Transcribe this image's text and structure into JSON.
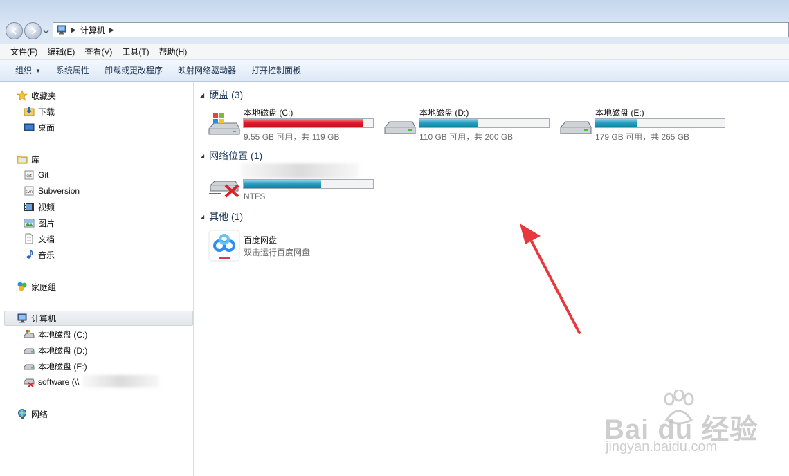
{
  "window": {
    "breadcrumb": [
      "计算机"
    ]
  },
  "menubar": {
    "items": [
      "文件(F)",
      "编辑(E)",
      "查看(V)",
      "工具(T)",
      "帮助(H)"
    ]
  },
  "toolbar": {
    "items": [
      "组织",
      "系统属性",
      "卸载或更改程序",
      "映射网络驱动器",
      "打开控制面板"
    ]
  },
  "sidebar": {
    "favorites": {
      "label": "收藏夹",
      "items": [
        "下载",
        "桌面"
      ]
    },
    "libraries": {
      "label": "库",
      "items": [
        "Git",
        "Subversion",
        "视频",
        "图片",
        "文档",
        "音乐"
      ]
    },
    "homegroup": {
      "label": "家庭组"
    },
    "computer": {
      "label": "计算机",
      "items": [
        "本地磁盘 (C:)",
        "本地磁盘 (D:)",
        "本地磁盘 (E:)",
        "software (\\\\"
      ]
    },
    "network": {
      "label": "网络"
    }
  },
  "content": {
    "groups": {
      "hdd": {
        "title": "硬盘 (3)",
        "drives": [
          {
            "name": "本地磁盘 (C:)",
            "info": "9.55 GB 可用，共 119 GB",
            "used_fraction": 0.92,
            "color": "#d81e2c"
          },
          {
            "name": "本地磁盘 (D:)",
            "info": "110 GB 可用，共 200 GB",
            "used_fraction": 0.45,
            "color": "#2aa3c5"
          },
          {
            "name": "本地磁盘 (E:)",
            "info": "179 GB 可用，共 265 GB",
            "used_fraction": 0.32,
            "color": "#2aa3c5"
          }
        ]
      },
      "network": {
        "title": "网络位置 (1)",
        "drive": {
          "info": "NTFS",
          "used_fraction": 0.6,
          "color": "#2aa3c5"
        }
      },
      "other": {
        "title": "其他 (1)",
        "item": {
          "name": "百度网盘",
          "desc": "双击运行百度网盘"
        }
      }
    }
  },
  "watermark": {
    "brand": "Bai du 经验",
    "url": "jingyan.baidu.com"
  },
  "colors": {
    "annotation_arrow": "#e8383d"
  }
}
